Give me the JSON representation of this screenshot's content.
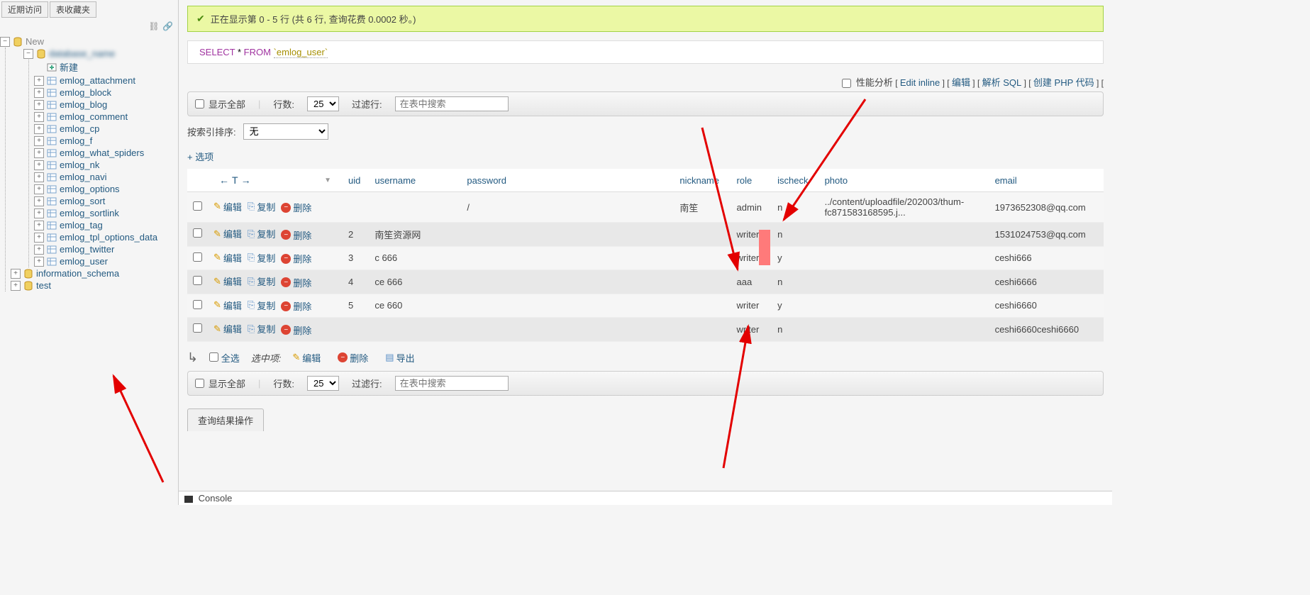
{
  "sidebar": {
    "tabs": {
      "recent": "近期访问",
      "favorites": "表收藏夹"
    },
    "root": "New",
    "new_action": "新建",
    "tables": [
      "emlog_attachment",
      "emlog_block",
      "emlog_blog",
      "emlog_comment",
      "emlog_cp",
      "emlog_f",
      "emlog_what_spiders",
      "emlog_nk",
      "emlog_navi",
      "emlog_options",
      "emlog_sort",
      "emlog_sortlink",
      "emlog_tag",
      "emlog_tpl_options_data",
      "emlog_twitter",
      "emlog_user"
    ],
    "other_dbs": [
      "information_schema",
      "test"
    ]
  },
  "success": {
    "text": "正在显示第 0 - 5 行 (共 6 行, 查询花费 0.0002 秒。)"
  },
  "sql": {
    "select": "SELECT",
    "star": "*",
    "from": "FROM",
    "table": "`emlog_user`"
  },
  "actions": {
    "profiling": "性能分析",
    "edit_inline": "Edit inline",
    "edit": "编辑",
    "parse_sql": "解析 SQL",
    "create_php": "创建 PHP 代码"
  },
  "controls": {
    "show_all": "显示全部",
    "rows_label": "行数:",
    "rows_value": "25",
    "filter_label": "过滤行:",
    "filter_placeholder": "在表中搜索"
  },
  "sort": {
    "label": "按索引排序:",
    "value": "无"
  },
  "options_link": "+ 选项",
  "columns": [
    "uid",
    "username",
    "password",
    "nickname",
    "role",
    "ischeck",
    "photo",
    "email"
  ],
  "row_actions": {
    "edit": "编辑",
    "copy": "复制",
    "delete": "删除"
  },
  "rows": [
    {
      "uid": "",
      "username": "",
      "password": "/",
      "nickname": "南笙",
      "role": "admin",
      "ischeck": "n",
      "photo": "../content/uploadfile/202003/thum-fc871583168595.j...",
      "email": "1973652308@qq.com"
    },
    {
      "uid": "2",
      "username": "南笙资源网",
      "password": "",
      "nickname": "",
      "role": "writer",
      "ischeck": "n",
      "photo": "",
      "email": "1531024753@qq.com"
    },
    {
      "uid": "3",
      "username": "c    666",
      "password": "",
      "nickname": "",
      "role": "writer",
      "ischeck": "y",
      "photo": "",
      "email": "ceshi666"
    },
    {
      "uid": "4",
      "username": "ce   666",
      "password": "",
      "nickname": "",
      "role": "aaa",
      "ischeck": "n",
      "photo": "",
      "email": "ceshi6666"
    },
    {
      "uid": "5",
      "username": "ce   660",
      "password": "",
      "nickname": "",
      "role": "writer",
      "ischeck": "y",
      "photo": "",
      "email": "ceshi6660"
    },
    {
      "uid": "",
      "username": "",
      "password": "",
      "nickname": "",
      "role": "writer",
      "ischeck": "n",
      "photo": "",
      "email": "ceshi6660ceshi6660"
    }
  ],
  "bulk": {
    "select_all": "全选",
    "with_selected": "选中项:",
    "edit": "编辑",
    "delete": "删除",
    "export": "导出"
  },
  "result_ops": "查询结果操作",
  "console": "Console"
}
